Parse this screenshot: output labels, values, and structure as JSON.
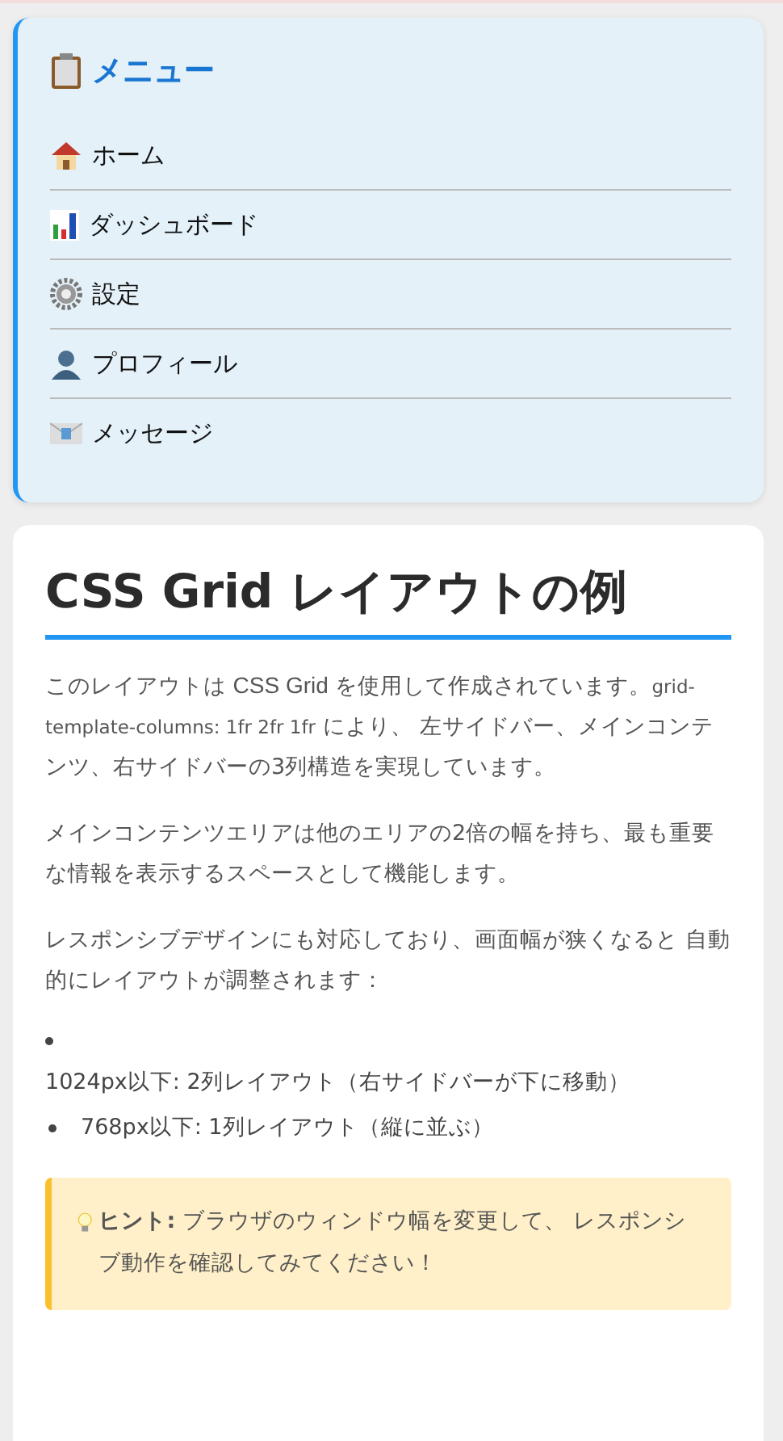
{
  "menu": {
    "title": "メニュー",
    "items": [
      {
        "label": "ホーム",
        "kind": "house"
      },
      {
        "label": "ダッシュボード",
        "kind": "chart"
      },
      {
        "label": "設定",
        "kind": "gear"
      },
      {
        "label": "プロフィール",
        "kind": "person"
      },
      {
        "label": "メッセージ",
        "kind": "mail"
      }
    ]
  },
  "main": {
    "heading": "CSS Grid レイアウトの例",
    "paragraphs": [
      {
        "segments": [
          {
            "kind": "text",
            "text": "このレイアウトは "
          },
          {
            "kind": "alt",
            "text": "CSS Grid"
          },
          {
            "kind": "text",
            "text": " を使用して作成されています。"
          },
          {
            "kind": "code",
            "text": "grid-template-columns: 1fr 2fr 1fr"
          },
          {
            "kind": "text",
            "text": " により、 左サイドバー、メインコンテンツ、右サイドバーの3列構造を実現しています。"
          }
        ]
      },
      {
        "segments": [
          {
            "kind": "text",
            "text": "メインコンテンツエリアは他のエリアの2倍の幅を持ち、最も重要な情報を表示するスペースとして機能します。"
          }
        ]
      },
      {
        "segments": [
          {
            "kind": "text",
            "text": "レスポンシブデザインにも対応しており、画面幅が狭くなると 自動的にレイアウトが調整されます："
          }
        ]
      }
    ],
    "list": [
      {
        "kind": "broken",
        "text": "1024px以下: 2列レイアウト（右サイドバーが下に移動）"
      },
      {
        "kind": "inline",
        "text": "768px以下: 1列レイアウト（縦に並ぶ）"
      }
    ],
    "hint": {
      "text": "**ヒント:** ブラウザのウィンドウ幅を変更して、 レスポンシブ動作を確認してみてください！"
    }
  }
}
